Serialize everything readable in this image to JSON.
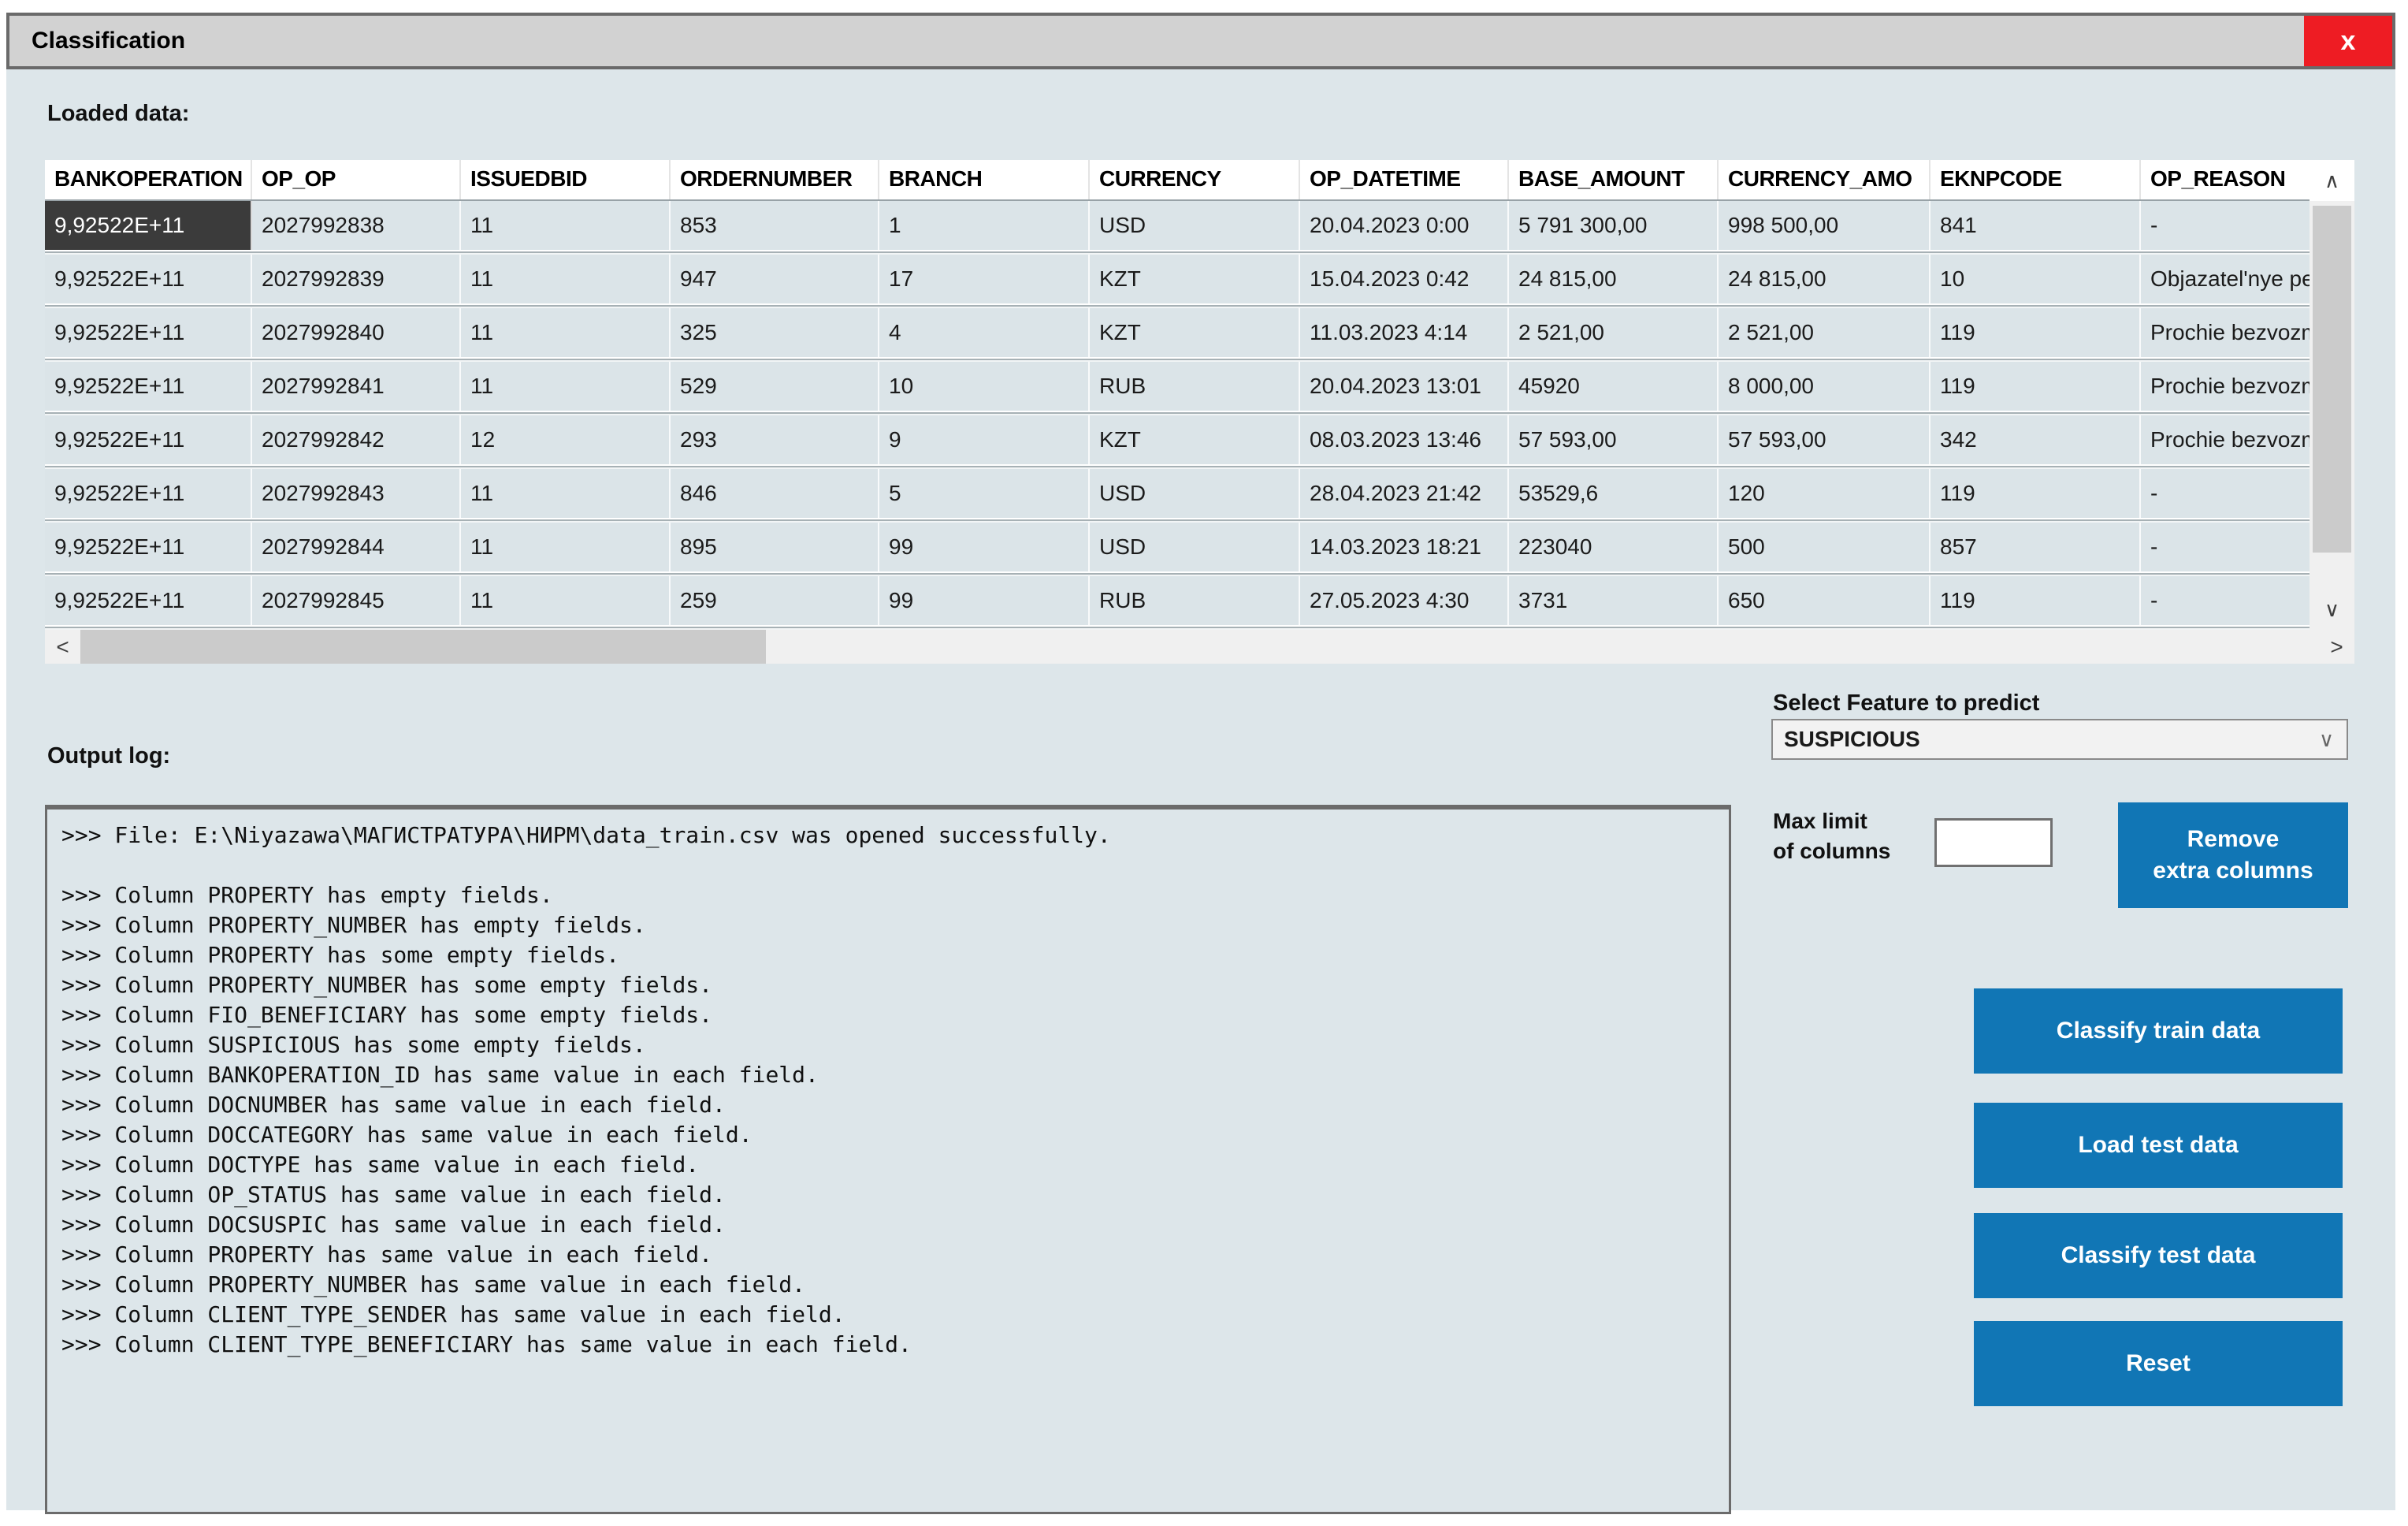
{
  "window": {
    "title": "Classification",
    "close_glyph": "x"
  },
  "colors": {
    "accent_blue": "#1176b5",
    "close_red": "#ee1c23",
    "bg": "#dde6ea",
    "titlebar": "#d2d2d2",
    "row_bg": "#dbe4e8",
    "selected_cell": "#3b3b3b",
    "track": "#f0f0f0",
    "thumb": "#cbcbcb"
  },
  "icons": {
    "up": "∧",
    "down": "∨",
    "left": "<",
    "right": ">"
  },
  "loaded_data": {
    "label": "Loaded data:",
    "columns": [
      "BANKOPERATION",
      "OP_OP",
      "ISSUEDBID",
      "ORDERNUMBER",
      "BRANCH",
      "CURRENCY",
      "OP_DATETIME",
      "BASE_AMOUNT",
      "CURRENCY_AMO",
      "EKNPCODE",
      "OP_REASON"
    ],
    "rows": [
      [
        "9,92522E+11",
        "2027992838",
        "11",
        "853",
        "1",
        "USD",
        "20.04.2023 0:00",
        "5 791 300,00",
        "998 500,00",
        "841",
        "-"
      ],
      [
        "9,92522E+11",
        "2027992839",
        "11",
        "947",
        "17",
        "KZT",
        "15.04.2023 0:42",
        "24 815,00",
        "24 815,00",
        "10",
        "Objazatel'nye pe"
      ],
      [
        "9,92522E+11",
        "2027992840",
        "11",
        "325",
        "4",
        "KZT",
        "11.03.2023 4:14",
        "2 521,00",
        "2 521,00",
        "119",
        "Prochie bezvozm"
      ],
      [
        "9,92522E+11",
        "2027992841",
        "11",
        "529",
        "10",
        "RUB",
        "20.04.2023 13:01",
        "45920",
        "8 000,00",
        "119",
        "Prochie bezvozm"
      ],
      [
        "9,92522E+11",
        "2027992842",
        "12",
        "293",
        "9",
        "KZT",
        "08.03.2023 13:46",
        "57 593,00",
        "57 593,00",
        "342",
        "Prochie bezvozm"
      ],
      [
        "9,92522E+11",
        "2027992843",
        "11",
        "846",
        "5",
        "USD",
        "28.04.2023 21:42",
        "53529,6",
        "120",
        "119",
        "-"
      ],
      [
        "9,92522E+11",
        "2027992844",
        "11",
        "895",
        "99",
        "USD",
        "14.03.2023 18:21",
        "223040",
        "500",
        "857",
        "-"
      ],
      [
        "9,92522E+11",
        "2027992845",
        "11",
        "259",
        "99",
        "RUB",
        "27.05.2023 4:30",
        "3731",
        "650",
        "119",
        "-"
      ]
    ],
    "selected_cell": {
      "row": 0,
      "col": 0
    }
  },
  "output_log": {
    "label": "Output log:",
    "lines": [
      ">>> File: E:\\Niyazawa\\МАГИСТРАТУРА\\НИРМ\\data_train.csv was opened successfully.",
      "",
      ">>> Column PROPERTY has empty fields.",
      ">>> Column PROPERTY_NUMBER has empty fields.",
      ">>> Column PROPERTY has some empty fields.",
      ">>> Column PROPERTY_NUMBER has some empty fields.",
      ">>> Column FIO_BENEFICIARY has some empty fields.",
      ">>> Column SUSPICIOUS has some empty fields.",
      ">>> Column BANKOPERATION_ID has same value in each field.",
      ">>> Column DOCNUMBER has same value in each field.",
      ">>> Column DOCCATEGORY has same value in each field.",
      ">>> Column DOCTYPE has same value in each field.",
      ">>> Column OP_STATUS has same value in each field.",
      ">>> Column DOCSUSPIC has same value in each field.",
      ">>> Column PROPERTY has same value in each field.",
      ">>> Column PROPERTY_NUMBER has same value in each field.",
      ">>> Column CLIENT_TYPE_SENDER has same value in each field.",
      ">>> Column CLIENT_TYPE_BENEFICIARY has same value in each field."
    ]
  },
  "controls": {
    "feature_label": "Select Feature to predict",
    "feature_value": "SUSPICIOUS",
    "max_limit_label_line1": "Max limit",
    "max_limit_label_line2": "of columns",
    "max_limit_value": "",
    "remove_button_line1": "Remove",
    "remove_button_line2": "extra columns",
    "action_buttons": [
      "Classify train data",
      "Load test data",
      "Classify test data",
      "Reset"
    ]
  }
}
